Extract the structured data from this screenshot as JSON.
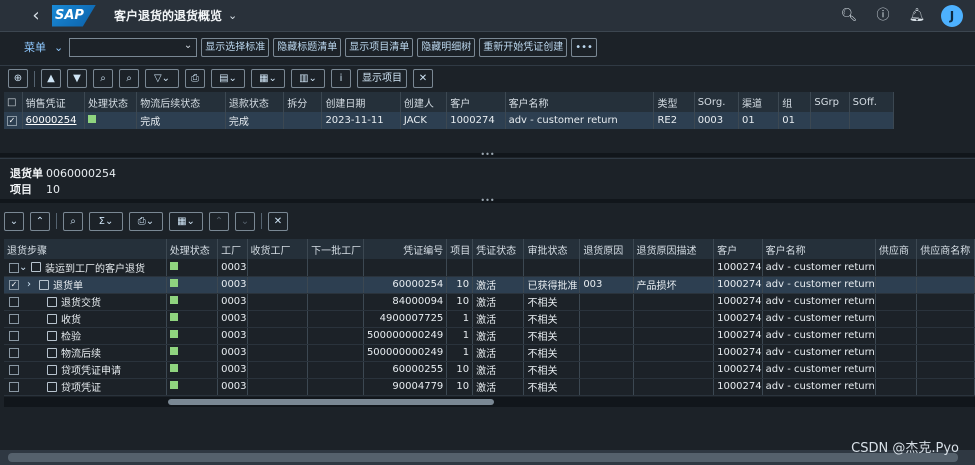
{
  "shell": {
    "logo": "SAP",
    "title": "客户退货的退货概览",
    "avatar": "J"
  },
  "toolbar1": {
    "menu": "菜单",
    "buttons": [
      "显示选择标准",
      "隐藏标题清单",
      "显示项目清单",
      "隐藏明细树",
      "重新开始凭证创建"
    ],
    "more": "•••"
  },
  "toolbar2": {
    "show_items": "显示项目"
  },
  "grid1": {
    "headers": [
      "销售凭证",
      "处理状态",
      "物流后续状态",
      "退款状态",
      "拆分",
      "创建日期",
      "创建人",
      "客户",
      "客户名称",
      "类型",
      "SOrg.",
      "渠道",
      "组",
      "SGrp",
      "SOff."
    ],
    "row": {
      "doc": "60000254",
      "logistics": "完成",
      "refund": "完成",
      "date": "2023-11-11",
      "creator": "JACK",
      "customer": "1000274",
      "name": "adv - customer return",
      "type": "RE2",
      "sorg": "0003",
      "channel": "01",
      "group": "01"
    }
  },
  "header_panel": {
    "label1": "退货单",
    "value1": "0060000254",
    "label2": "项目",
    "value2": "10"
  },
  "grid2": {
    "headers": [
      "退货步骤",
      "处理状态",
      "工厂",
      "收货工厂",
      "下一批工厂",
      "凭证编号",
      "项目",
      "凭证状态",
      "审批状态",
      "退货原因",
      "退货原因描述",
      "客户",
      "客户名称",
      "供应商",
      "供应商名称"
    ],
    "rows": [
      {
        "step": "装运到工厂的客户退货",
        "plant": "0003",
        "doc": "",
        "item": "",
        "status": "",
        "approval": "",
        "reason": "",
        "reason_desc": "",
        "customer": "1000274",
        "name": "adv - customer return"
      },
      {
        "step": "退货单",
        "plant": "0003",
        "doc": "60000254",
        "item": "10",
        "status": "激活",
        "approval": "已获得批准",
        "reason": "003",
        "reason_desc": "产品损坏",
        "customer": "1000274",
        "name": "adv - customer return"
      },
      {
        "step": "退货交货",
        "plant": "0003",
        "doc": "84000094",
        "item": "10",
        "status": "激活",
        "approval": "不相关",
        "reason": "",
        "reason_desc": "",
        "customer": "1000274",
        "name": "adv - customer return"
      },
      {
        "step": "收货",
        "plant": "0003",
        "doc": "4900007725",
        "item": "1",
        "status": "激活",
        "approval": "不相关",
        "reason": "",
        "reason_desc": "",
        "customer": "1000274",
        "name": "adv - customer return"
      },
      {
        "step": "检验",
        "plant": "0003",
        "doc": "500000000249",
        "item": "1",
        "status": "激活",
        "approval": "不相关",
        "reason": "",
        "reason_desc": "",
        "customer": "1000274",
        "name": "adv - customer return"
      },
      {
        "step": "物流后续",
        "plant": "0003",
        "doc": "500000000249",
        "item": "1",
        "status": "激活",
        "approval": "不相关",
        "reason": "",
        "reason_desc": "",
        "customer": "1000274",
        "name": "adv - customer return"
      },
      {
        "step": "贷项凭证申请",
        "plant": "0003",
        "doc": "60000255",
        "item": "10",
        "status": "激活",
        "approval": "不相关",
        "reason": "",
        "reason_desc": "",
        "customer": "1000274",
        "name": "adv - customer return"
      },
      {
        "step": "贷项凭证",
        "plant": "0003",
        "doc": "90004779",
        "item": "10",
        "status": "激活",
        "approval": "不相关",
        "reason": "",
        "reason_desc": "",
        "customer": "1000274",
        "name": "adv - customer return"
      }
    ]
  },
  "watermark": "CSDN @杰克.Pyo"
}
